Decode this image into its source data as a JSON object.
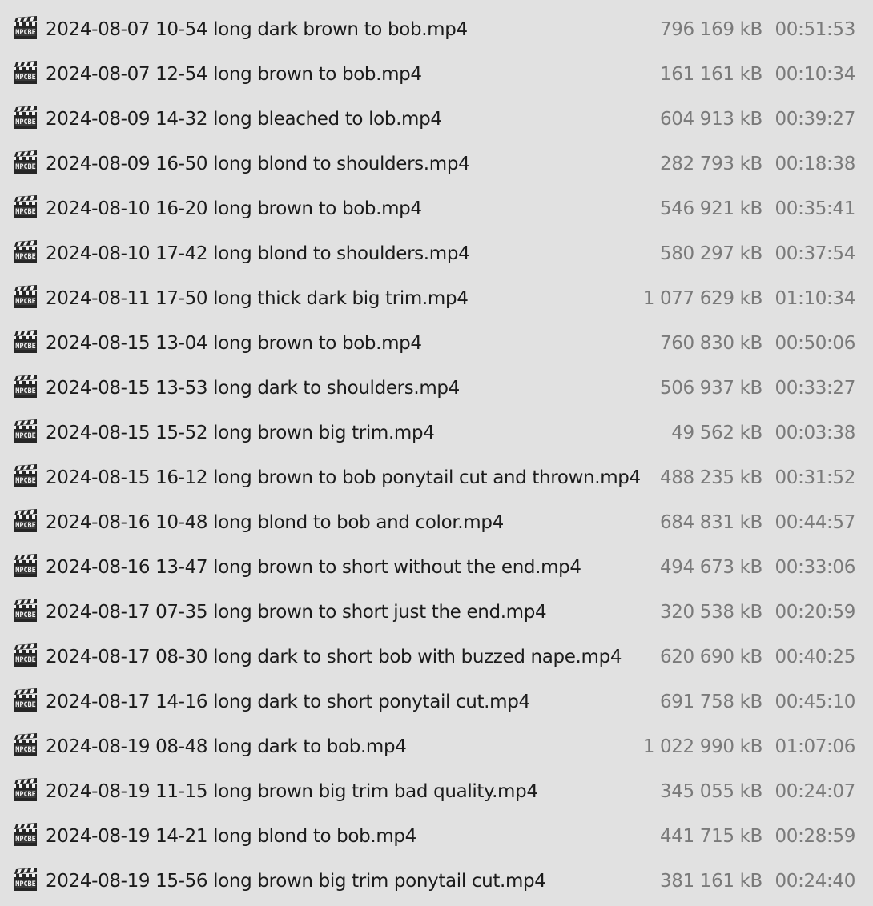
{
  "files": [
    {
      "name": "2024-08-07 10-54 long dark brown to bob.mp4",
      "size": "796 169 kB",
      "length": "00:51:53",
      "icon": "mpc-be-video-file-icon"
    },
    {
      "name": "2024-08-07 12-54 long brown to bob.mp4",
      "size": "161 161 kB",
      "length": "00:10:34",
      "icon": "mpc-be-video-file-icon"
    },
    {
      "name": "2024-08-09 14-32 long bleached to lob.mp4",
      "size": "604 913 kB",
      "length": "00:39:27",
      "icon": "mpc-be-video-file-icon"
    },
    {
      "name": "2024-08-09 16-50 long blond to shoulders.mp4",
      "size": "282 793 kB",
      "length": "00:18:38",
      "icon": "mpc-be-video-file-icon"
    },
    {
      "name": "2024-08-10 16-20 long brown to bob.mp4",
      "size": "546 921 kB",
      "length": "00:35:41",
      "icon": "mpc-be-video-file-icon"
    },
    {
      "name": "2024-08-10 17-42 long blond to shoulders.mp4",
      "size": "580 297 kB",
      "length": "00:37:54",
      "icon": "mpc-be-video-file-icon"
    },
    {
      "name": "2024-08-11 17-50 long thick dark big trim.mp4",
      "size": "1 077 629 kB",
      "length": "01:10:34",
      "icon": "mpc-be-video-file-icon"
    },
    {
      "name": "2024-08-15 13-04 long brown to bob.mp4",
      "size": "760 830 kB",
      "length": "00:50:06",
      "icon": "mpc-be-video-file-icon"
    },
    {
      "name": "2024-08-15 13-53 long dark to shoulders.mp4",
      "size": "506 937 kB",
      "length": "00:33:27",
      "icon": "mpc-be-video-file-icon"
    },
    {
      "name": "2024-08-15 15-52 long brown big trim.mp4",
      "size": "49 562 kB",
      "length": "00:03:38",
      "icon": "mpc-be-video-file-icon"
    },
    {
      "name": "2024-08-15 16-12 long brown to bob ponytail cut and thrown.mp4",
      "size": "488 235 kB",
      "length": "00:31:52",
      "icon": "mpc-be-video-file-icon"
    },
    {
      "name": "2024-08-16 10-48 long blond to bob and color.mp4",
      "size": "684 831 kB",
      "length": "00:44:57",
      "icon": "mpc-be-video-file-icon"
    },
    {
      "name": "2024-08-16 13-47 long brown to short without the end.mp4",
      "size": "494 673 kB",
      "length": "00:33:06",
      "icon": "mpc-be-video-file-icon"
    },
    {
      "name": "2024-08-17 07-35 long brown to short just the end.mp4",
      "size": "320 538 kB",
      "length": "00:20:59",
      "icon": "mpc-be-video-file-icon"
    },
    {
      "name": "2024-08-17 08-30 long dark to short bob with buzzed nape.mp4",
      "size": "620 690 kB",
      "length": "00:40:25",
      "icon": "mpc-be-video-file-icon"
    },
    {
      "name": "2024-08-17 14-16 long dark to short ponytail cut.mp4",
      "size": "691 758 kB",
      "length": "00:45:10",
      "icon": "mpc-be-video-file-icon"
    },
    {
      "name": "2024-08-19 08-48 long dark to bob.mp4",
      "size": "1 022 990 kB",
      "length": "01:07:06",
      "icon": "mpc-be-video-file-icon"
    },
    {
      "name": "2024-08-19 11-15 long brown big trim bad quality.mp4",
      "size": "345 055 kB",
      "length": "00:24:07",
      "icon": "mpc-be-video-file-icon"
    },
    {
      "name": "2024-08-19 14-21 long blond to bob.mp4",
      "size": "441 715 kB",
      "length": "00:28:59",
      "icon": "mpc-be-video-file-icon"
    },
    {
      "name": "2024-08-19 15-56 long brown big trim ponytail cut.mp4",
      "size": "381 161 kB",
      "length": "00:24:40",
      "icon": "mpc-be-video-file-icon"
    }
  ],
  "colors": {
    "background": "#e1e1e1",
    "name_text": "#1b1b1b",
    "secondary_text": "#7a7a7a"
  }
}
